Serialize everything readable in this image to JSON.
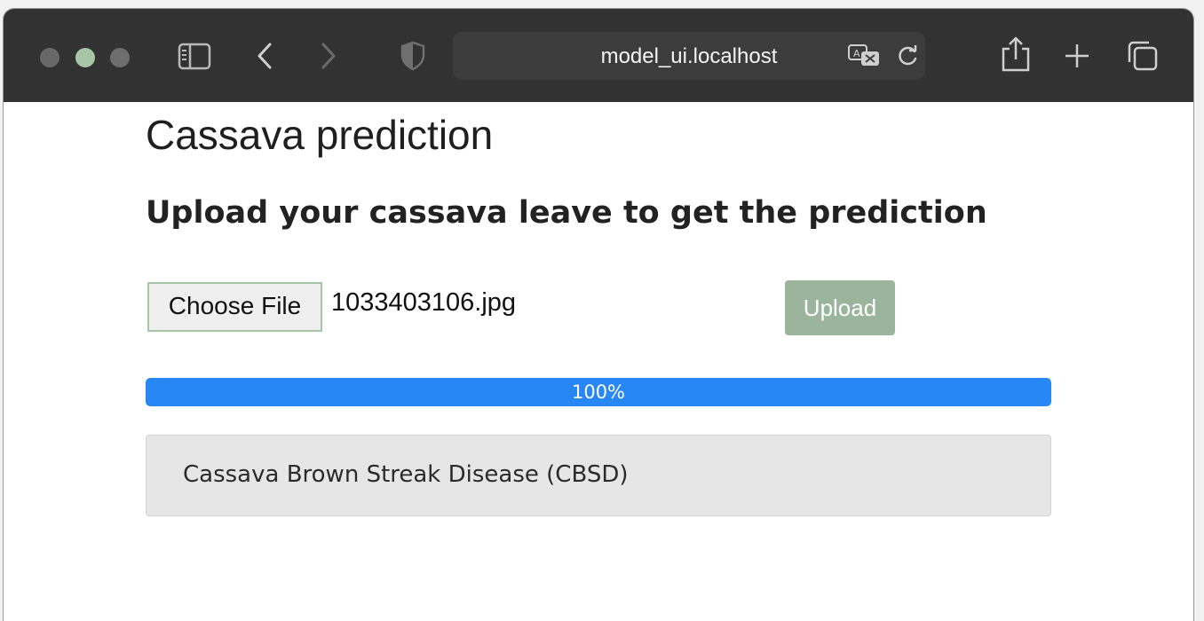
{
  "browser": {
    "address": "model_ui.localhost",
    "icons": [
      "sidebar-icon",
      "back-icon",
      "forward-icon",
      "shield-icon",
      "translate-icon",
      "reload-icon",
      "share-icon",
      "new-tab-icon",
      "tabs-overview-icon"
    ]
  },
  "page": {
    "title": "Cassava prediction",
    "subtitle": "Upload your cassava leave to get the prediction"
  },
  "upload": {
    "choose_file_label": "Choose File",
    "file_name": "1033403106.jpg",
    "upload_label": "Upload"
  },
  "progress": {
    "value_percent": 100,
    "label": "100%"
  },
  "result": {
    "text": "Cassava Brown Streak Disease (CBSD)"
  },
  "colors": {
    "toolbar": "#333233",
    "progress_fill": "#2687f5",
    "upload_button": "#9bb59d",
    "result_background": "#e6e6e7"
  }
}
